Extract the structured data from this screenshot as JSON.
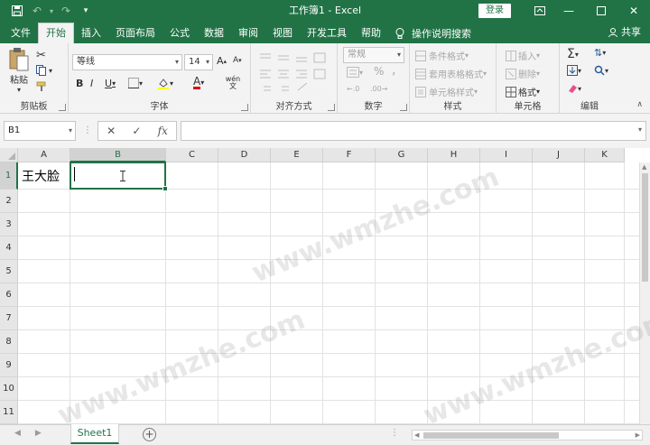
{
  "window": {
    "title": "工作簿1 - Excel",
    "login_label": "登录",
    "share_label": "共享"
  },
  "tabs": [
    {
      "label": "文件"
    },
    {
      "label": "开始"
    },
    {
      "label": "插入"
    },
    {
      "label": "页面布局"
    },
    {
      "label": "公式"
    },
    {
      "label": "数据"
    },
    {
      "label": "审阅"
    },
    {
      "label": "视图"
    },
    {
      "label": "开发工具"
    },
    {
      "label": "帮助"
    }
  ],
  "active_tab": "开始",
  "tell_me": "操作说明搜索",
  "ribbon": {
    "clipboard": {
      "label": "剪贴板",
      "paste": "粘贴"
    },
    "font": {
      "label": "字体",
      "font_name": "等线",
      "font_size": "14",
      "wen": "wén 文"
    },
    "alignment": {
      "label": "对齐方式"
    },
    "number": {
      "label": "数字",
      "format": "常规"
    },
    "styles": {
      "label": "样式",
      "conditional": "条件格式",
      "table": "套用表格格式",
      "cell": "单元格样式"
    },
    "cells": {
      "label": "单元格",
      "insert": "插入",
      "delete": "删除",
      "format": "格式"
    },
    "editing": {
      "label": "编辑"
    }
  },
  "formula_bar": {
    "name_box": "B1",
    "cancel": "✕",
    "enter": "✓",
    "fx": "fx",
    "content": ""
  },
  "grid": {
    "columns": [
      "A",
      "B",
      "C",
      "D",
      "E",
      "F",
      "G",
      "H",
      "I",
      "J",
      "K"
    ],
    "rows": [
      "1",
      "2",
      "3",
      "4",
      "5",
      "6",
      "7",
      "8",
      "9",
      "10",
      "11"
    ],
    "selected_column": "B",
    "selected_row": "1",
    "cells": {
      "A1": "王大脸"
    }
  },
  "sheets": [
    {
      "name": "Sheet1"
    }
  ],
  "colors": {
    "brand": "#217346"
  },
  "watermark": "www.wmzhe.com"
}
